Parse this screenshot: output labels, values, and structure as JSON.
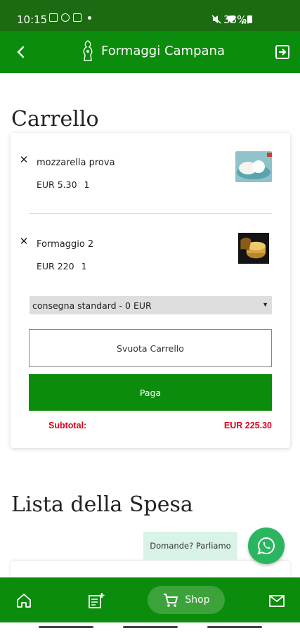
{
  "status_bar": {
    "time": "10:15",
    "battery": "38%"
  },
  "header": {
    "title": "Formaggi Campana"
  },
  "cart": {
    "heading": "Carrello",
    "items": [
      {
        "name": "mozzarella prova",
        "price": "EUR 5.30",
        "qty": "1"
      },
      {
        "name": "Formaggio 2",
        "price": "EUR 220",
        "qty": "1"
      }
    ],
    "shipping_selected": "consegna standard - 0 EUR",
    "empty_button": "Svuota Carrello",
    "pay_button": "Paga",
    "subtotal_label": "Subtotal:",
    "subtotal_value": "EUR 225.30"
  },
  "shopping_list": {
    "heading": "Lista della Spesa"
  },
  "chat": {
    "bubble_text": "Domande? Parliamo"
  },
  "bottom_nav": {
    "shop_label": "Shop"
  },
  "colors": {
    "primary": "#0c8c0c",
    "statusbar": "#1c6b12",
    "subtotal": "#e0001b",
    "whatsapp": "#2cb560",
    "chat_bubble": "#d9f4e6"
  },
  "icons": [
    "back-arrow-icon",
    "cheese-logo-icon",
    "logout-icon",
    "close-icon",
    "whatsapp-icon",
    "home-icon",
    "add-list-icon",
    "cart-icon",
    "mail-icon"
  ]
}
